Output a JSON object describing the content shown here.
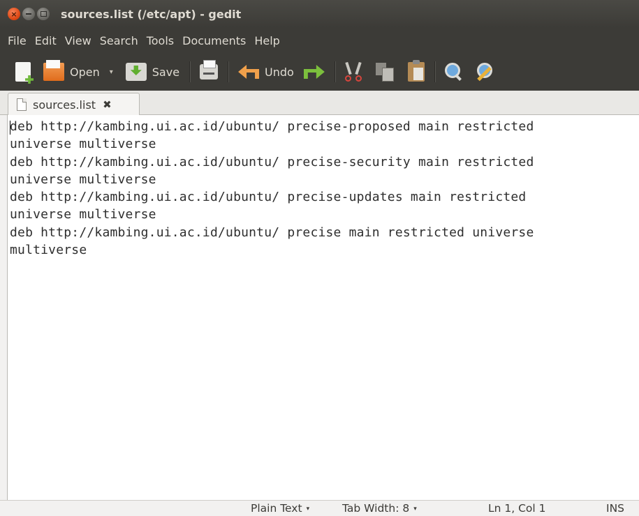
{
  "window": {
    "title": "sources.list (/etc/apt) - gedit",
    "close_glyph": "×"
  },
  "menubar": {
    "items": [
      "File",
      "Edit",
      "View",
      "Search",
      "Tools",
      "Documents",
      "Help"
    ]
  },
  "toolbar": {
    "new_icon": "new-document-icon",
    "open_label": "Open",
    "open_arrow": "▾",
    "save_label": "Save",
    "print_icon": "print-icon",
    "undo_label": "Undo",
    "redo_icon": "redo-icon",
    "cut_icon": "scissors-icon",
    "copy_icon": "copy-icon",
    "paste_icon": "paste-icon",
    "find_icon": "magnifier-icon",
    "replace_icon": "find-replace-icon"
  },
  "tabs": [
    {
      "label": "sources.list",
      "close_glyph": "✖",
      "active": true
    }
  ],
  "editor": {
    "lines": [
      "deb http://kambing.ui.ac.id/ubuntu/ precise-proposed main restricted",
      "universe multiverse",
      "deb http://kambing.ui.ac.id/ubuntu/ precise-security main restricted",
      "universe multiverse",
      "deb http://kambing.ui.ac.id/ubuntu/ precise-updates main restricted",
      "universe multiverse",
      "deb http://kambing.ui.ac.id/ubuntu/ precise main restricted universe",
      "multiverse"
    ]
  },
  "statusbar": {
    "language": "Plain Text",
    "tab_width": "Tab Width: 8",
    "arrow": "▾",
    "position": "Ln 1, Col 1",
    "mode": "INS"
  },
  "colors": {
    "titlebar": "#3c3b37",
    "close_button": "#df4a16",
    "editor_bg": "#ffffff",
    "text": "#2e2e2e"
  }
}
